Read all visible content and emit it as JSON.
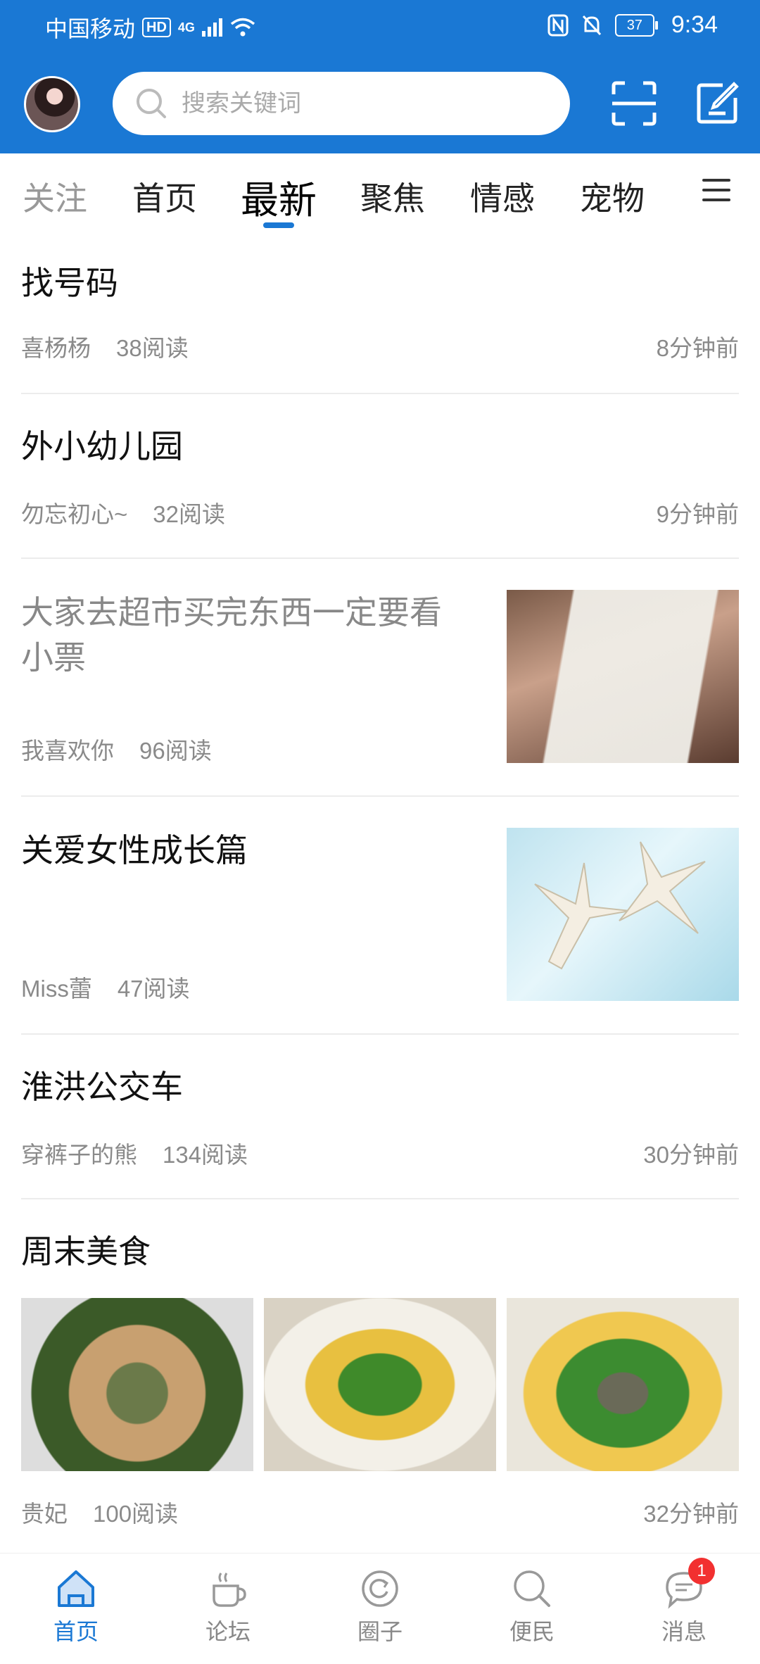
{
  "status": {
    "carrier": "中国移动",
    "hd": "HD",
    "network": "4G",
    "battery": "37",
    "time": "9:34"
  },
  "search": {
    "placeholder": "搜索关键词"
  },
  "tabs": [
    {
      "label": "关注"
    },
    {
      "label": "首页"
    },
    {
      "label": "最新"
    },
    {
      "label": "聚焦"
    },
    {
      "label": "情感"
    },
    {
      "label": "宠物"
    }
  ],
  "feed": [
    {
      "title": "找号码",
      "author": "喜杨杨",
      "reads": "38阅读",
      "time": "8分钟前"
    },
    {
      "title": "外小幼儿园",
      "author": "勿忘初心~",
      "reads": "32阅读",
      "time": "9分钟前"
    },
    {
      "title": "大家去超市买完东西一定要看小票",
      "author": "我喜欢你",
      "reads": "96阅读",
      "thumb": "receipt-photo"
    },
    {
      "title": "关爱女性成长篇",
      "author": "Miss蕾",
      "reads": "47阅读",
      "thumb": "starfish-photo"
    },
    {
      "title": "淮洪公交车",
      "author": "穿裤子的熊",
      "reads": "134阅读",
      "time": "30分钟前"
    },
    {
      "title": "周末美食",
      "author": "贵妃",
      "reads": "100阅读",
      "time": "32分钟前",
      "images": [
        "food-photo-1",
        "food-photo-2",
        "food-photo-3"
      ]
    }
  ],
  "bottom_nav": [
    {
      "label": "首页",
      "icon": "home-icon",
      "active": true
    },
    {
      "label": "论坛",
      "icon": "coffee-cup-icon"
    },
    {
      "label": "圈子",
      "icon": "circle-refresh-icon"
    },
    {
      "label": "便民",
      "icon": "search-icon"
    },
    {
      "label": "消息",
      "icon": "chat-bubble-icon",
      "badge": "1"
    }
  ],
  "colors": {
    "brand": "#1a78d4",
    "badge": "#f23030"
  }
}
